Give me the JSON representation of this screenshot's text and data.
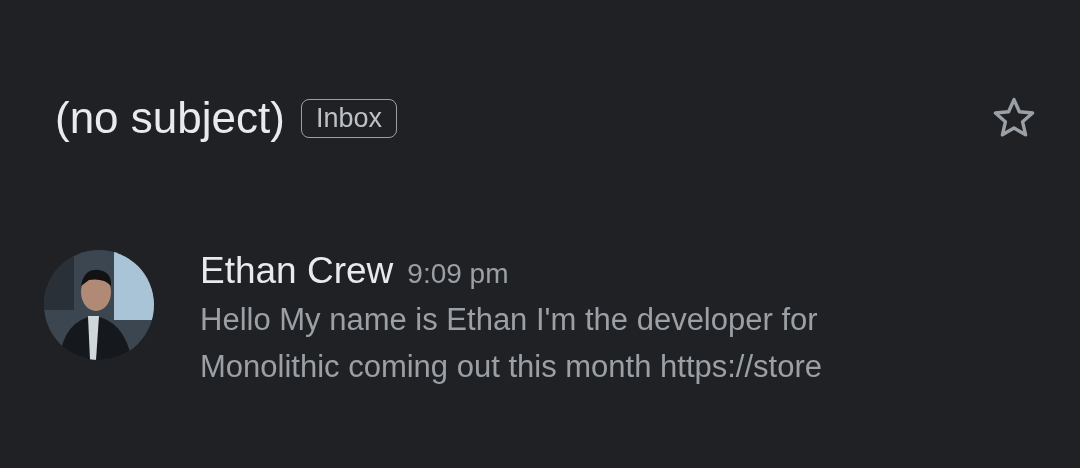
{
  "header": {
    "subject": "(no subject)",
    "label": "Inbox",
    "starred": false
  },
  "message": {
    "sender": "Ethan Crew",
    "time": "9:09 pm",
    "snippet_lines": [
      "Hello My name is Ethan I'm the developer for",
      "Monolithic coming out this month https://store"
    ]
  }
}
